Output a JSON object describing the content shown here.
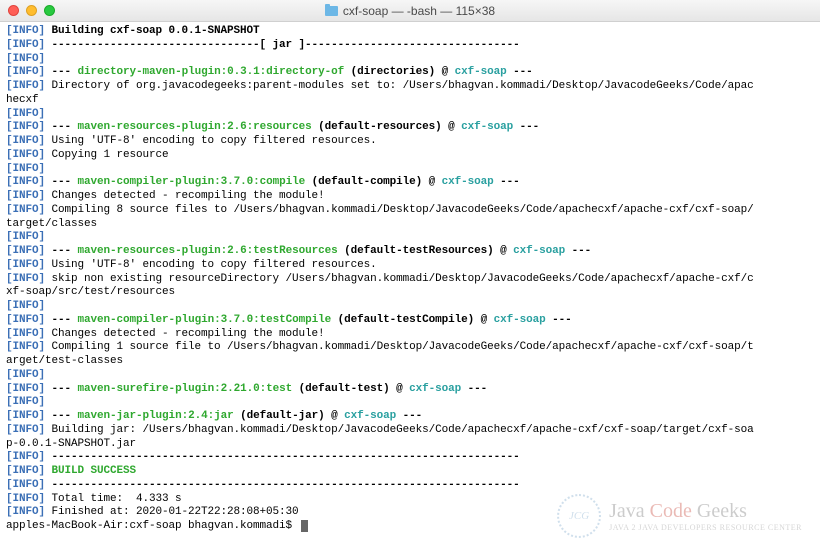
{
  "window": {
    "title": "cxf-soap — -bash — 115×38"
  },
  "tag": "[INFO]",
  "lines": [
    {
      "pre": " ",
      "text": "Building cxf-soap 0.0.1-SNAPSHOT",
      "bold": true
    },
    {
      "pre": " ",
      "text": "--------------------------------[ jar ]---------------------------------",
      "bold": true
    },
    {
      "pre": ""
    },
    {
      "pre": " ",
      "seg": [
        "--- ",
        {
          "g": "directory-maven-plugin:0.3.1:directory-of"
        },
        " ",
        {
          "b": "(directories)"
        },
        " @ ",
        {
          "c": "cxf-soap"
        },
        " ---"
      ],
      "bold": true
    },
    {
      "pre": " ",
      "text": "Directory of org.javacodegeeks:parent-modules set to: /Users/bhagvan.kommadi/Desktop/JavacodeGeeks/Code/apachecxf",
      "wrap": true,
      "wrapPrefix": "hecxf"
    },
    {
      "pre": ""
    },
    {
      "pre": " ",
      "seg": [
        "--- ",
        {
          "g": "maven-resources-plugin:2.6:resources"
        },
        " ",
        {
          "b": "(default-resources)"
        },
        " @ ",
        {
          "c": "cxf-soap"
        },
        " ---"
      ],
      "bold": true
    },
    {
      "pre": " ",
      "text": "Using 'UTF-8' encoding to copy filtered resources."
    },
    {
      "pre": " ",
      "text": "Copying 1 resource"
    },
    {
      "pre": ""
    },
    {
      "pre": " ",
      "seg": [
        "--- ",
        {
          "g": "maven-compiler-plugin:3.7.0:compile"
        },
        " ",
        {
          "b": "(default-compile)"
        },
        " @ ",
        {
          "c": "cxf-soap"
        },
        " ---"
      ],
      "bold": true
    },
    {
      "pre": " ",
      "text": "Changes detected - recompiling the module!"
    },
    {
      "pre": " ",
      "text": "Compiling 8 source files to /Users/bhagvan.kommadi/Desktop/JavacodeGeeks/Code/apachecxf/apache-cxf/cxf-soap/target/classes",
      "wrap": true,
      "wrapPrefix": "target/classes"
    },
    {
      "pre": ""
    },
    {
      "pre": " ",
      "seg": [
        "--- ",
        {
          "g": "maven-resources-plugin:2.6:testResources"
        },
        " ",
        {
          "b": "(default-testResources)"
        },
        " @ ",
        {
          "c": "cxf-soap"
        },
        " ---"
      ],
      "bold": true
    },
    {
      "pre": " ",
      "text": "Using 'UTF-8' encoding to copy filtered resources."
    },
    {
      "pre": " ",
      "text": "skip non existing resourceDirectory /Users/bhagvan.kommadi/Desktop/JavacodeGeeks/Code/apachecxf/apache-cxf/cxf-soap/src/test/resources",
      "wrap": true,
      "wrapPrefix": "xf-soap/src/test/resources"
    },
    {
      "pre": ""
    },
    {
      "pre": " ",
      "seg": [
        "--- ",
        {
          "g": "maven-compiler-plugin:3.7.0:testCompile"
        },
        " ",
        {
          "b": "(default-testCompile)"
        },
        " @ ",
        {
          "c": "cxf-soap"
        },
        " ---"
      ],
      "bold": true
    },
    {
      "pre": " ",
      "text": "Changes detected - recompiling the module!"
    },
    {
      "pre": " ",
      "text": "Compiling 1 source file to /Users/bhagvan.kommadi/Desktop/JavacodeGeeks/Code/apachecxf/apache-cxf/cxf-soap/target/test-classes",
      "wrap": true,
      "wrapPrefix": "arget/test-classes"
    },
    {
      "pre": ""
    },
    {
      "pre": " ",
      "seg": [
        "--- ",
        {
          "g": "maven-surefire-plugin:2.21.0:test"
        },
        " ",
        {
          "b": "(default-test)"
        },
        " @ ",
        {
          "c": "cxf-soap"
        },
        " ---"
      ],
      "bold": true
    },
    {
      "pre": ""
    },
    {
      "pre": " ",
      "seg": [
        "--- ",
        {
          "g": "maven-jar-plugin:2.4:jar"
        },
        " ",
        {
          "b": "(default-jar)"
        },
        " @ ",
        {
          "c": "cxf-soap"
        },
        " ---"
      ],
      "bold": true
    },
    {
      "pre": " ",
      "text": "Building jar: /Users/bhagvan.kommadi/Desktop/JavacodeGeeks/Code/apachecxf/apache-cxf/cxf-soap/target/cxf-soap-0.0.1-SNAPSHOT.jar",
      "wrap": true,
      "wrapPrefix": "p-0.0.1-SNAPSHOT.jar"
    },
    {
      "pre": " ",
      "text": "------------------------------------------------------------------------",
      "bold": true
    },
    {
      "pre": " ",
      "seg": [
        {
          "g": "BUILD SUCCESS"
        }
      ],
      "bold": true
    },
    {
      "pre": " ",
      "text": "------------------------------------------------------------------------",
      "bold": true
    },
    {
      "pre": " ",
      "text": "Total time:  4.333 s"
    },
    {
      "pre": " ",
      "text": "Finished at: 2020-01-22T22:28:08+05:30"
    }
  ],
  "prompt": "apples-MacBook-Air:cxf-soap bhagvan.kommadi$ ",
  "watermark": {
    "badge": "JCG",
    "line1a": "Java ",
    "line1b": "Code",
    "line1c": " Geeks",
    "line2": "JAVA 2 JAVA DEVELOPERS RESOURCE CENTER"
  }
}
